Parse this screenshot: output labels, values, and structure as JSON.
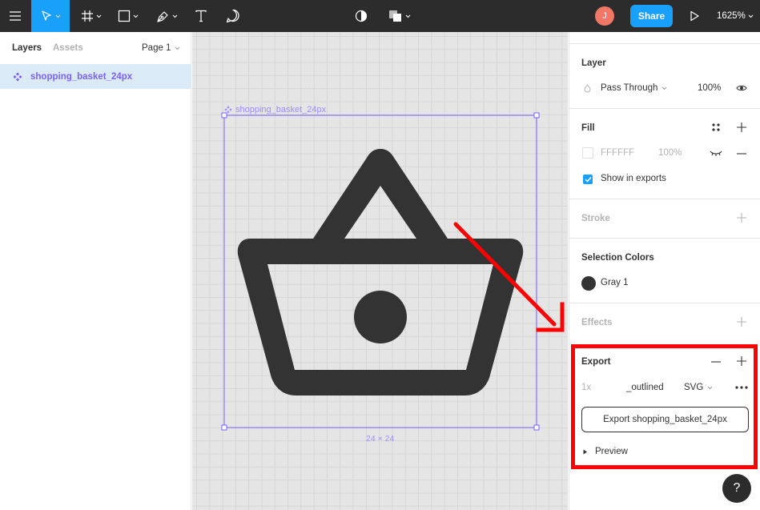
{
  "toolbar": {
    "tools": [
      {
        "name": "menu-icon"
      },
      {
        "name": "move-tool-icon"
      },
      {
        "name": "frame-tool-icon"
      },
      {
        "name": "shape-tool-icon"
      },
      {
        "name": "pen-tool-icon"
      },
      {
        "name": "text-tool-icon"
      },
      {
        "name": "comment-tool-icon"
      }
    ],
    "user_initial": "J",
    "share_label": "Share",
    "zoom": "1625%"
  },
  "left_panel": {
    "tab_layers": "Layers",
    "tab_assets": "Assets",
    "page_label": "Page 1",
    "layer_name": "shopping_basket_24px"
  },
  "canvas": {
    "frame_label": "shopping_basket_24px",
    "frame_size": "24 × 24",
    "icon_color": "#333333",
    "selection_color": "#7b61ff"
  },
  "right_panel": {
    "layer": {
      "title": "Layer",
      "blend_mode": "Pass Through",
      "opacity": "100%"
    },
    "fill": {
      "title": "Fill",
      "hex": "FFFFFF",
      "opacity": "100%",
      "show_in_exports": "Show in exports"
    },
    "stroke": {
      "title": "Stroke"
    },
    "selection_colors": {
      "title": "Selection Colors",
      "color_name": "Gray 1"
    },
    "effects": {
      "title": "Effects"
    },
    "export": {
      "title": "Export",
      "scale": "1x",
      "suffix": "_outlined",
      "format": "SVG",
      "button_label": "Export shopping_basket_24px",
      "preview_label": "Preview"
    }
  },
  "annotation": {
    "highlight_color": "#ff0000"
  }
}
